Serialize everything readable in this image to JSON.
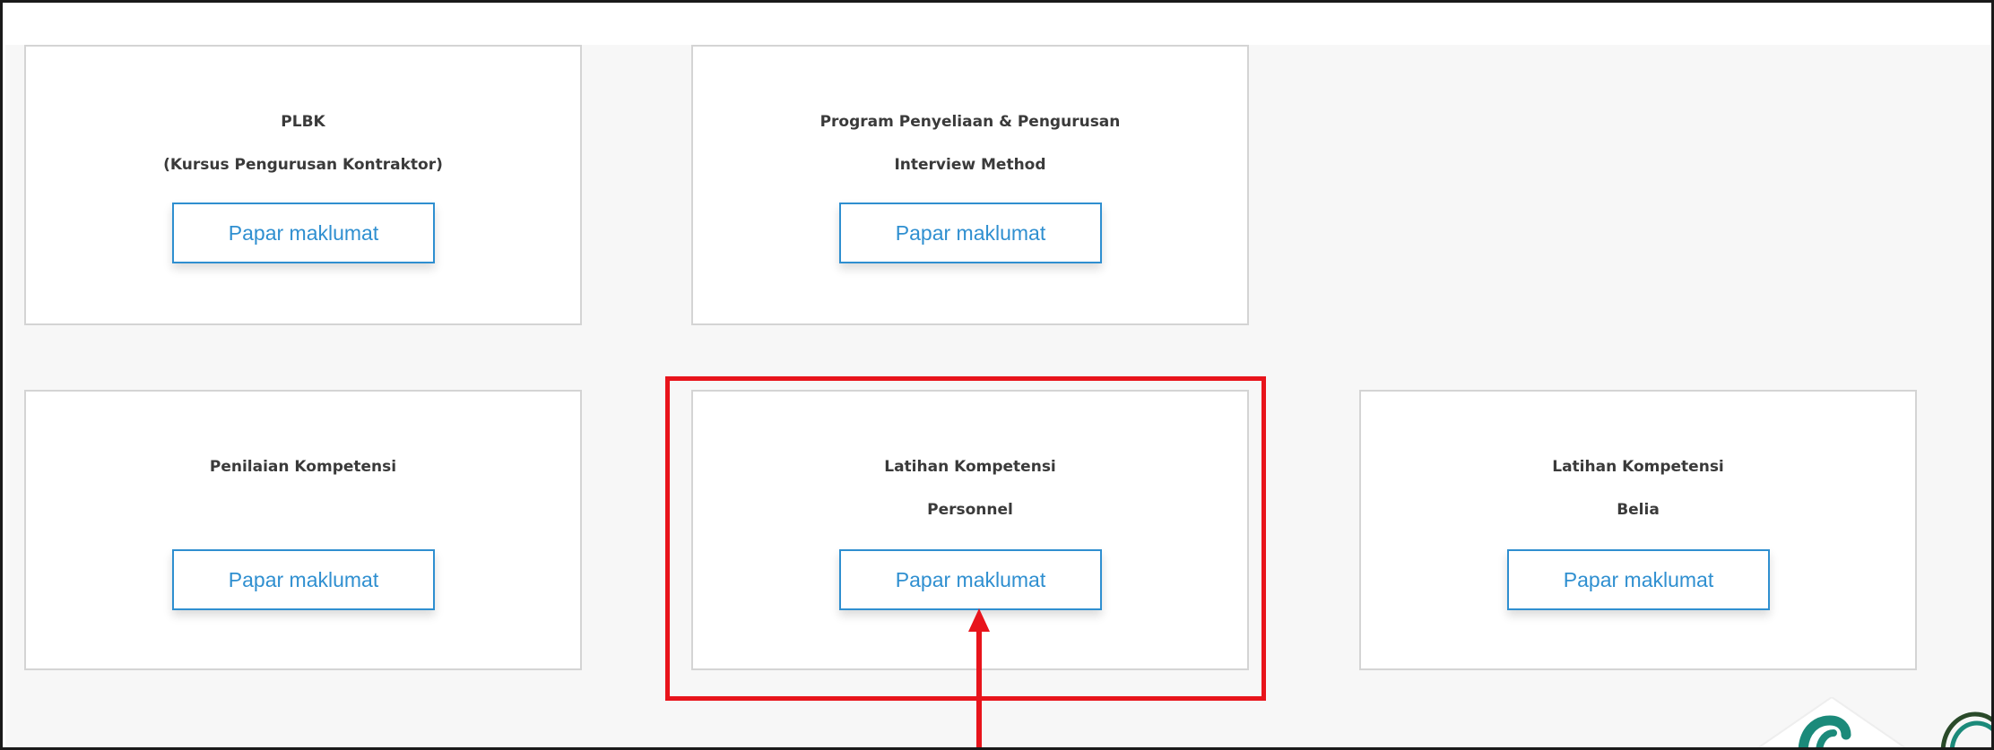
{
  "cards": [
    {
      "title_lines": [
        "PLBK",
        "(Kursus Pengurusan Kontraktor)"
      ],
      "button_label": "Papar maklumat"
    },
    {
      "title_lines": [
        "Program Penyeliaan & Pengurusan",
        "Interview Method"
      ],
      "button_label": "Papar maklumat"
    },
    {
      "title_lines": [
        "Penilaian Kompetensi"
      ],
      "button_label": "Papar maklumat"
    },
    {
      "title_lines": [
        "Latihan Kompetensi",
        "Personnel"
      ],
      "button_label": "Papar maklumat"
    },
    {
      "title_lines": [
        "Latihan Kompetensi",
        "Belia"
      ],
      "button_label": "Papar maklumat"
    }
  ],
  "colors": {
    "accent": "#2f8fd0",
    "annotation": "#e8141b",
    "logo_green": "#1b8a7a"
  },
  "icons": {
    "logo": "organization-logo-icon",
    "annotation_arrow": "up-arrow-icon"
  }
}
